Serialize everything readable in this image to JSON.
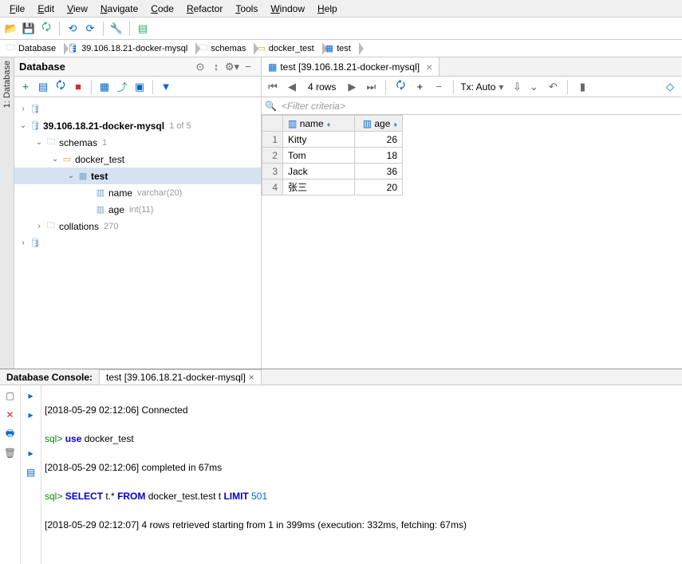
{
  "menu": {
    "file": "File",
    "edit": "Edit",
    "view": "View",
    "navigate": "Navigate",
    "code": "Code",
    "refactor": "Refactor",
    "tools": "Tools",
    "window": "Window",
    "help": "Help"
  },
  "breadcrumb": {
    "b0": "Database",
    "b1": "39.106.18.21-docker-mysql",
    "b2": "schemas",
    "b3": "docker_test",
    "b4": "test"
  },
  "sidebar": {
    "strip_label": "1: Database",
    "title": "Database"
  },
  "tree": {
    "conn": "39.106.18.21-docker-mysql",
    "conn_sub": "1 of 5",
    "schemas": "schemas",
    "schemas_sub": "1",
    "db": "docker_test",
    "table": "test",
    "col1": "name",
    "col1_type": "varchar(20)",
    "col2": "age",
    "col2_type": "int(11)",
    "collations": "collations",
    "collations_sub": "270"
  },
  "editor": {
    "tab_title": "test [39.106.18.21-docker-mysql]",
    "row_count": "4 rows",
    "tx_mode": "Tx: Auto",
    "filter_placeholder": "<Filter criteria>",
    "col_name": "name",
    "col_age": "age",
    "rows": [
      {
        "n": "1",
        "name": "Kitty",
        "age": "26"
      },
      {
        "n": "2",
        "name": "Tom",
        "age": "18"
      },
      {
        "n": "3",
        "name": "Jack",
        "age": "36"
      },
      {
        "n": "4",
        "name": "张三",
        "age": "20"
      }
    ]
  },
  "console": {
    "title": "Database Console:",
    "tab": "test [39.106.18.21-docker-mysql]",
    "l1_ts": "[2018-05-29 02:12:06]",
    "l1_msg": "Connected",
    "l2_prompt": "sql>",
    "l2_kw": "use",
    "l2_arg": "docker_test",
    "l3_ts": "[2018-05-29 02:12:06]",
    "l3_msg": "completed in 67ms",
    "l4_prompt": "sql>",
    "l4_sql_1": "SELECT",
    "l4_sql_2": " t.* ",
    "l4_sql_3": "FROM",
    "l4_sql_4": " docker_test.test t ",
    "l4_sql_5": "LIMIT",
    "l4_sql_6": " 501",
    "l5_ts": "[2018-05-29 02:12:07]",
    "l5_msg": "4 rows retrieved starting from 1 in 399ms (execution: 332ms, fetching: 67ms)"
  }
}
